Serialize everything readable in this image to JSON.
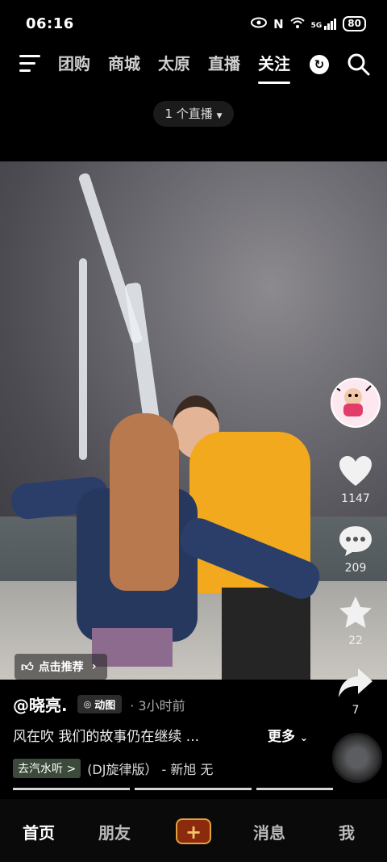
{
  "status_bar": {
    "time": "06:16",
    "network": "5G",
    "battery": "80"
  },
  "top_nav": {
    "tabs": [
      {
        "label": "团购",
        "active": false
      },
      {
        "label": "商城",
        "active": false
      },
      {
        "label": "太原",
        "active": false
      },
      {
        "label": "直播",
        "active": false
      },
      {
        "label": "关注",
        "active": true
      }
    ]
  },
  "live_pill": {
    "label": "1 个直播"
  },
  "video": {
    "recommend_label": "点击推荐"
  },
  "rail": {
    "likes": "1147",
    "comments": "209",
    "favorites": "22",
    "shares": "7"
  },
  "post": {
    "author": "@晓亮.",
    "tag": "动图",
    "time_ago": "· 3小时前",
    "caption": "风在吹 我们的故事仍在继续 ...",
    "more": "更多",
    "music_tag": "去汽水听 >",
    "music_title": "(DJ旋律版） - 新旭    无"
  },
  "progress": {
    "segments": 3,
    "current": 1
  },
  "bottom_nav": {
    "home": "首页",
    "friends": "朋友",
    "messages": "消息",
    "me": "我"
  },
  "colors": {
    "accent": "#f3a91e",
    "add_button": "#8b2a0d"
  }
}
